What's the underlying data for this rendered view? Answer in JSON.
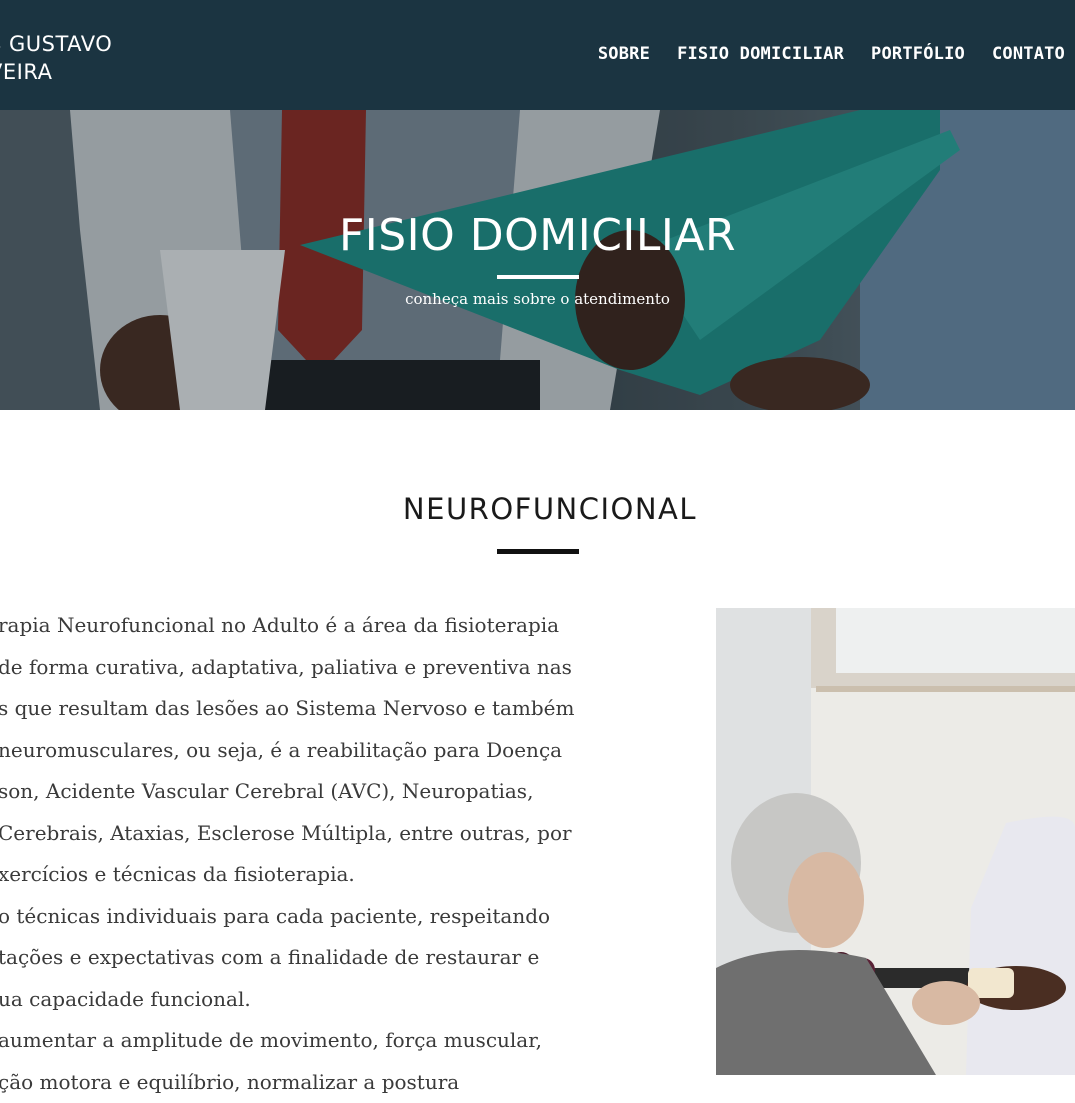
{
  "header": {
    "brand_line1": "S GUSTAVO",
    "brand_line2": "VEIRA",
    "nav": [
      "SOBRE",
      "FISIO DOMICILIAR",
      "PORTFÓLIO",
      "CONTATO"
    ]
  },
  "hero": {
    "title": "FISIO DOMICILIAR",
    "subtitle": "conheça mais sobre o atendimento"
  },
  "section": {
    "title": "NEUROFUNCIONAL",
    "lines": [
      "rapia Neurofuncional no Adulto é a área da fisioterapia",
      "de forma curativa, adaptativa, paliativa e preventiva nas",
      "s que resultam das lesões ao Sistema Nervoso e também",
      "neuromusculares, ou seja, é a reabilitação para Doença",
      "son, Acidente Vascular Cerebral (AVC), Neuropatias,",
      "Cerebrais, Ataxias, Esclerose Múltipla, entre outras, por",
      "xercícios e técnicas da fisioterapia.",
      "o técnicas individuais para cada paciente, respeitando",
      "tações e expectativas com a finalidade de restaurar e",
      "ua capacidade funcional.",
      "aumentar a amplitude de movimento, força muscular,",
      "ção motora e equilíbrio, normalizar a postura"
    ]
  },
  "colors": {
    "nav_bg": "#1b3441",
    "hero_teal": "#1e8f87",
    "text": "#3a3a3a"
  }
}
